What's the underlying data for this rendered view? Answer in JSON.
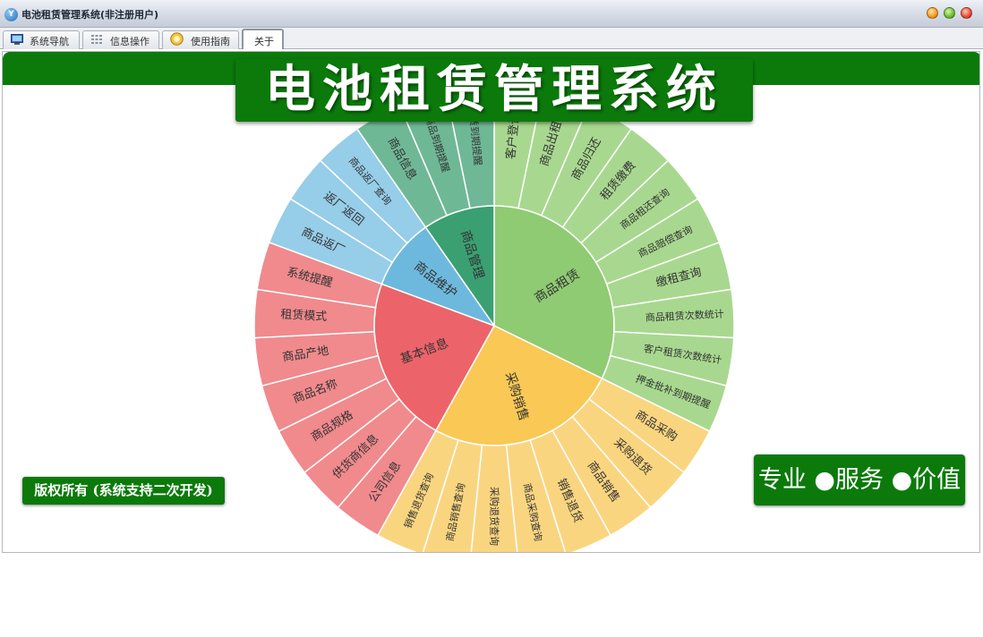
{
  "window": {
    "title": "电池租赁管理系统(非注册用户)",
    "app_icon": "Y"
  },
  "tabs": [
    {
      "label": "系统导航",
      "icon": "monitor-icon",
      "active": false
    },
    {
      "label": "信息操作",
      "icon": "grid-icon",
      "active": false
    },
    {
      "label": "使用指南",
      "icon": "help-icon",
      "active": false
    },
    {
      "label": "关于",
      "icon": "",
      "active": true
    }
  ],
  "banner": {
    "title": "电池租赁管理系统"
  },
  "footer": {
    "copyright": "版权所有 (系统支持二次开发)",
    "slogan": "专业 ●服务 ●价值"
  },
  "colors": {
    "brand_green": "#0b7a0b",
    "segment_green": "#8fcb72",
    "segment_teal": "#3aa072",
    "segment_blue": "#6db9dd",
    "segment_red": "#ec6469",
    "segment_yellow": "#f9c855"
  },
  "chart_data": {
    "type": "sunburst",
    "groups": [
      {
        "name": "商品租赁",
        "color_inner": "#8fcb72",
        "color_outer": "#a8d88f",
        "items": [
          "客户登记",
          "商品出租",
          "商品归还",
          "租赁缴费",
          "商品租还查询",
          "商品赔偿查询",
          "缴租查询",
          "商品租赁次数统计",
          "客户租赁次数统计",
          "押金批补到期提醒"
        ]
      },
      {
        "name": "采购销售",
        "color_inner": "#f9c855",
        "color_outer": "#fad580",
        "items": [
          "商品采购",
          "采购退货",
          "商品销售",
          "销售退货",
          "商品采购查询",
          "采购退货查询",
          "商品销售查询",
          "销售退货查询"
        ]
      },
      {
        "name": "基本信息",
        "color_inner": "#ec6469",
        "color_outer": "#f08a8d",
        "items": [
          "公司信息",
          "供货商信息",
          "商品规格",
          "商品名称",
          "商品产地",
          "租赁模式",
          "系统提醒"
        ]
      },
      {
        "name": "商品维护",
        "color_inner": "#6db9dd",
        "color_outer": "#96cde8",
        "items": [
          "商品返厂",
          "返厂返回",
          "商品返厂查询"
        ]
      },
      {
        "name": "商品管理",
        "color_inner": "#3aa072",
        "color_outer": "#6fb896",
        "items": [
          "商品信息",
          "商品到期提醒",
          "租赁到期提醒"
        ]
      }
    ]
  }
}
